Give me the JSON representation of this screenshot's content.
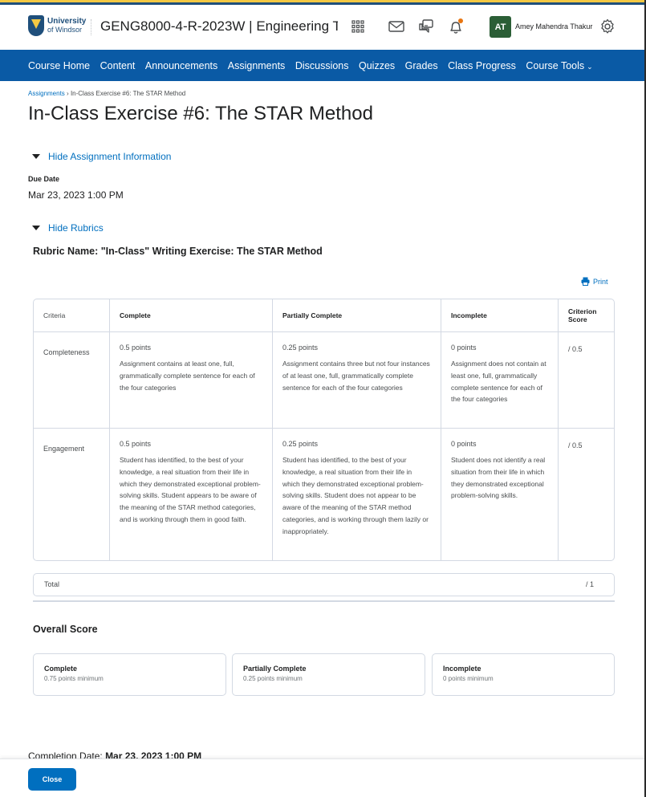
{
  "header": {
    "logo_line1": "University",
    "logo_line2": "of Windsor",
    "course_title": "GENG8000-4-R-2023W | Engineering T...",
    "user_initials": "AT",
    "user_name": "Amey Mahendra Thakur",
    "icons": [
      "apps-grid-icon",
      "mail-icon",
      "chat-icon",
      "bell-icon",
      "gear-icon"
    ],
    "notification_dot_color": "#e87511"
  },
  "nav": {
    "items": [
      "Course Home",
      "Content",
      "Announcements",
      "Assignments",
      "Discussions",
      "Quizzes",
      "Grades",
      "Class Progress",
      "Course Tools"
    ],
    "bg_color": "#0a5aa5"
  },
  "breadcrumb": {
    "parent": "Assignments",
    "separator": "›",
    "current": "In-Class Exercise #6: The STAR Method"
  },
  "page_title": "In-Class Exercise #6: The STAR Method",
  "assignment_info": {
    "toggle_label": "Hide Assignment Information",
    "due_label": "Due Date",
    "due_value": "Mar 23, 2023 1:00 PM"
  },
  "rubrics": {
    "toggle_label": "Hide Rubrics",
    "rubric_name": "Rubric Name: \"In-Class\" Writing Exercise: The STAR Method",
    "print_label": "Print",
    "headers": [
      "Criteria",
      "Complete",
      "Partially Complete",
      "Incomplete",
      "Criterion Score"
    ],
    "rows": [
      {
        "criterion": "Completeness",
        "levels": [
          {
            "points": "0.5 points",
            "desc": "Assignment contains at least one, full, grammatically complete sentence for each of the four categories"
          },
          {
            "points": "0.25 points",
            "desc": "Assignment contains three but not four instances of at least one, full, grammatically complete sentence for each of the four categories"
          },
          {
            "points": "0 points",
            "desc": "Assignment does not contain at least one, full, grammatically complete sentence for each of the four categories"
          }
        ],
        "score": "/ 0.5"
      },
      {
        "criterion": "Engagement",
        "levels": [
          {
            "points": "0.5 points",
            "desc": "Student has identified, to the best of your knowledge, a real situation from their life in which they demonstrated exceptional problem-solving skills. Student appears to be aware of the meaning of the STAR method categories, and is working through them in good faith."
          },
          {
            "points": "0.25 points",
            "desc": "Student has identified, to the best of your knowledge, a real situation from their life in which they demonstrated exceptional problem-solving skills. Student does not appear to be aware of the meaning of the STAR method categories, and is working through them lazily or inappropriately."
          },
          {
            "points": "0 points",
            "desc": "Student does not identify a real situation from their life in which they demonstrated exceptional problem-solving skills."
          }
        ],
        "score": "/ 0.5"
      }
    ],
    "total_label": "Total",
    "total_value": "/ 1"
  },
  "overall_score": {
    "title": "Overall Score",
    "levels": [
      {
        "name": "Complete",
        "min": "0.75 points minimum"
      },
      {
        "name": "Partially Complete",
        "min": "0.25 points minimum"
      },
      {
        "name": "Incomplete",
        "min": "0 points minimum"
      }
    ]
  },
  "completion": {
    "label": "Completion Date:",
    "value": "Mar 23, 2023 1:00 PM"
  },
  "footer": {
    "close_label": "Close"
  }
}
